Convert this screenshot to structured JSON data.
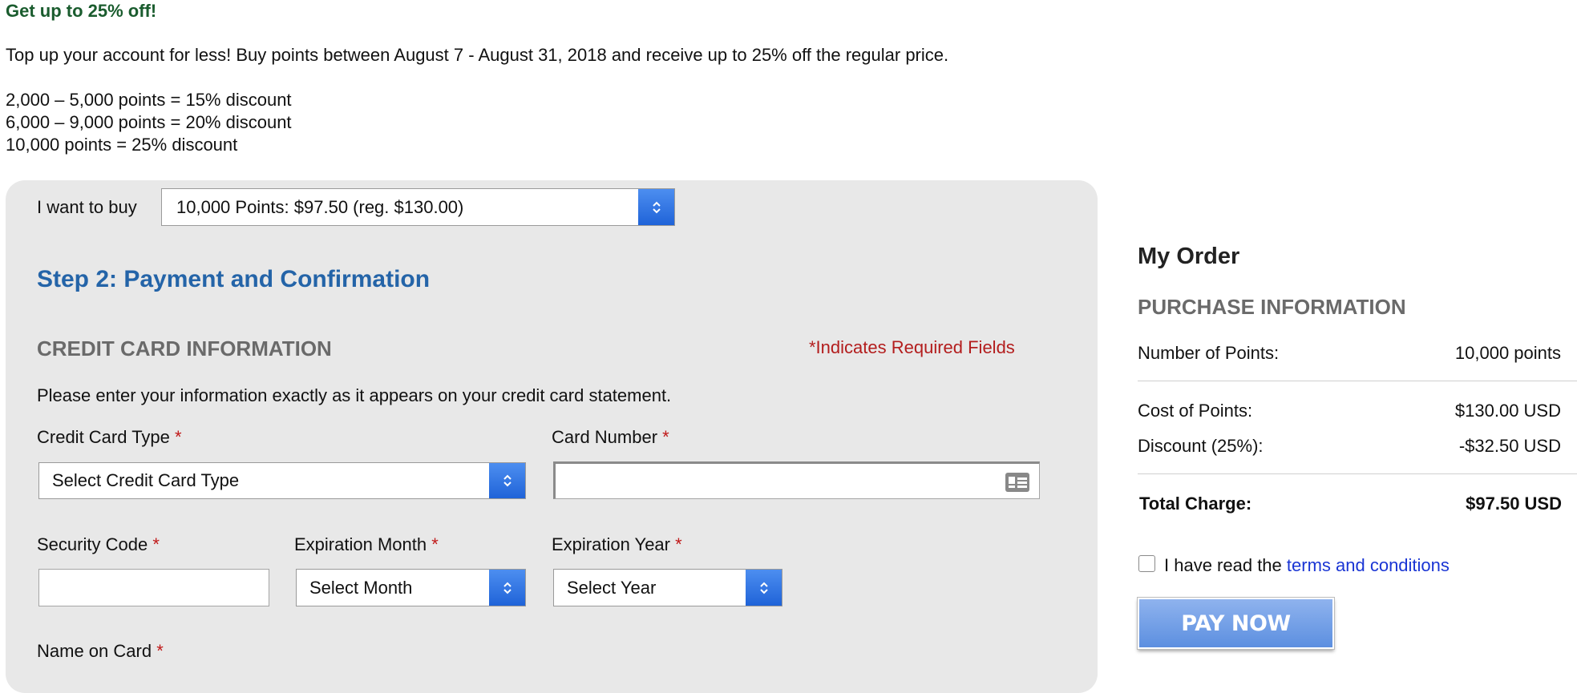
{
  "promo": {
    "title": "Get up to 25% off!",
    "description": "Top up your account for less! Buy points between August 7 - August 31, 2018 and receive up to 25% off the regular price.",
    "tiers": [
      "2,000 – 5,000 points = 15% discount",
      "6,000 – 9,000 points = 20% discount",
      "10,000 points = 25% discount"
    ]
  },
  "purchase": {
    "label": "I want to buy",
    "selected": "10,000 Points: $97.50 (reg. $130.00)"
  },
  "step": {
    "title": "Step 2: Payment and Confirmation"
  },
  "credit_card": {
    "title": "CREDIT CARD INFORMATION",
    "required_note": "*Indicates Required Fields",
    "instructions": "Please enter your information exactly as it appears on your credit card statement.",
    "card_type_label": "Credit Card Type",
    "card_type_selected": "Select Credit Card Type",
    "card_number_label": "Card Number",
    "card_number_value": "",
    "security_code_label": "Security Code",
    "security_code_value": "",
    "exp_month_label": "Expiration Month",
    "exp_month_selected": "Select Month",
    "exp_year_label": "Expiration Year",
    "exp_year_selected": "Select Year",
    "name_label": "Name on Card",
    "required_marker": "*"
  },
  "order": {
    "title": "My Order",
    "section": "PURCHASE INFORMATION",
    "points_label": "Number of Points:",
    "points_value": "10,000 points",
    "cost_label": "Cost of Points:",
    "cost_value": "$130.00 USD",
    "discount_label": "Discount (25%):",
    "discount_value": "-$32.50 USD",
    "total_label": "Total Charge:",
    "total_value": "$97.50 USD",
    "terms_prefix": "I have read the",
    "terms_link": "terms and conditions",
    "terms_checked": false,
    "pay_button": "PAY NOW"
  },
  "colors": {
    "promo_title": "#1a5c2e",
    "step_title": "#2464a8",
    "required": "#c01818",
    "link": "#1a35d4",
    "select_arrow": "#2a6fe0",
    "pay_button": "#6d9be6",
    "panel_bg": "#e8e8e8"
  },
  "icons": {
    "select_arrow": "chevron-up-down-icon",
    "card_field": "id-card-icon"
  }
}
